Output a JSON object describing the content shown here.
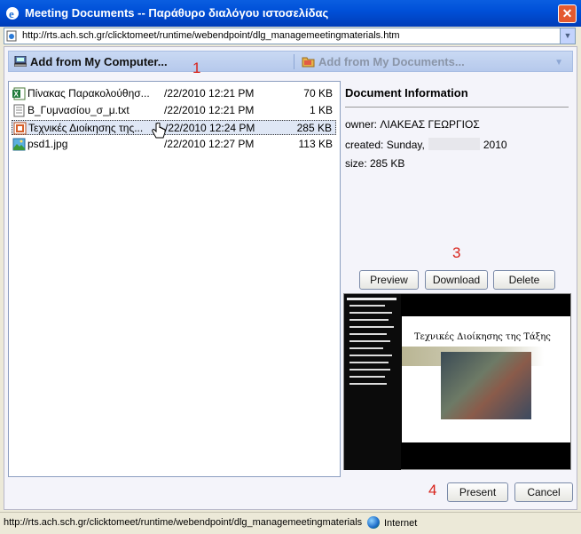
{
  "window": {
    "title": "Meeting Documents -- Παράθυρο διαλόγου ιστοσελίδας",
    "address": "http://rts.ach.sch.gr/clicktomeet/runtime/webendpoint/dlg_managemeetingmaterials.htm"
  },
  "toolbar": {
    "add_from_computer": "Add from My Computer...",
    "add_from_documents": "Add from My Documents..."
  },
  "markers": [
    "1",
    "2",
    "3",
    "4"
  ],
  "files": [
    {
      "name": "Πίνακας Παρακολούθησ...",
      "date": "/22/2010 12:21 PM",
      "size": "70 KB",
      "icon": "excel-icon"
    },
    {
      "name": "Β_Γυμνασίου_σ_μ.txt",
      "date": "/22/2010 12:21 PM",
      "size": "1 KB",
      "icon": "text-file-icon"
    },
    {
      "name": "Τεχνικές Διοίκησης της...",
      "date": "/22/2010 12:24 PM",
      "size": "285 KB",
      "icon": "powerpoint-icon"
    },
    {
      "name": "psd1.jpg",
      "date": "/22/2010 12:27 PM",
      "size": "113 KB",
      "icon": "image-file-icon"
    }
  ],
  "doc_info": {
    "heading": "Document Information",
    "owner": "owner: ΛΙΑΚΕΑΣ ΓΕΩΡΓΙΟΣ",
    "created_prefix": "created: Sunday,",
    "created_year": "2010",
    "size": "size: 285 KB"
  },
  "buttons": {
    "preview": "Preview",
    "download": "Download",
    "delete": "Delete",
    "present": "Present",
    "cancel": "Cancel"
  },
  "slide": {
    "title": "Τεχνικές Διοίκησης της Τάξης"
  },
  "status": {
    "url": "http://rts.ach.sch.gr/clicktomeet/runtime/webendpoint/dlg_managemeetingmaterials",
    "zone": "Internet"
  }
}
